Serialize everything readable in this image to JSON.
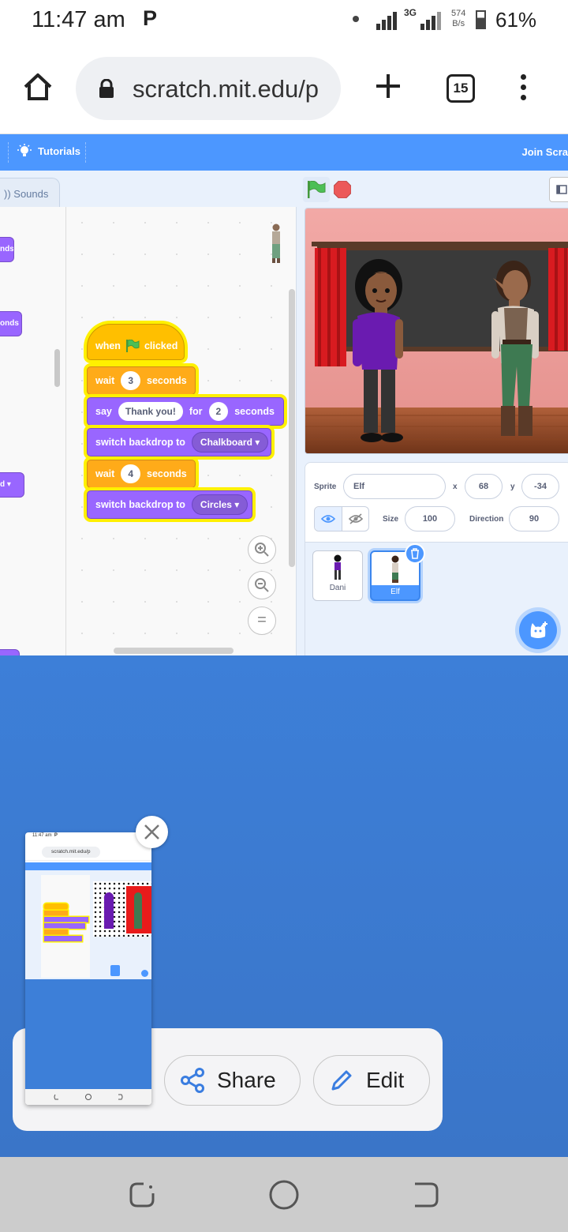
{
  "status_bar": {
    "time": "11:47 am",
    "notification_icon": "P",
    "network": "3G",
    "speed_value": "574",
    "speed_unit": "B/s",
    "battery": "61%"
  },
  "browser": {
    "url": "scratch.mit.edu/p",
    "tab_count": "15"
  },
  "scratch": {
    "menu_tutorials": "Tutorials",
    "menu_join": "Join Scra",
    "tab_sounds": "Sounds",
    "palette_blocks": [
      "nds",
      "onds",
      "d"
    ],
    "script": {
      "when": "when",
      "clicked": "clicked",
      "wait1_label": "wait",
      "wait1_value": "3",
      "wait1_unit": "seconds",
      "say_label": "say",
      "say_text": "Thank you!",
      "say_for": "for",
      "say_secs": "2",
      "say_unit": "seconds",
      "switch1_label": "switch backdrop to",
      "switch1_value": "Chalkboard",
      "wait2_label": "wait",
      "wait2_value": "4",
      "wait2_unit": "seconds",
      "switch2_label": "switch backdrop to",
      "switch2_value": "Circles"
    },
    "zoom": {
      "reset": "="
    },
    "sprite_info": {
      "sprite_label": "Sprite",
      "sprite_name": "Elf",
      "x_label": "x",
      "x_value": "68",
      "y_label": "y",
      "y_value": "-34",
      "size_label": "Size",
      "size_value": "100",
      "direction_label": "Direction",
      "direction_value": "90"
    },
    "sprites": [
      {
        "name": "Dani"
      },
      {
        "name": "Elf"
      }
    ]
  },
  "share_sheet": {
    "share_label": "Share",
    "edit_label": "Edit"
  },
  "thumbnail": {
    "time": "11:47 am",
    "p": "P",
    "url": "scratch.mit.edu/p"
  },
  "colors": {
    "scratch_blue": "#4c97ff",
    "looks_purple": "#9966ff",
    "control_orange": "#ffab19",
    "events_yellow": "#ffbf00",
    "overlay_blue": "#3d7fd8"
  }
}
